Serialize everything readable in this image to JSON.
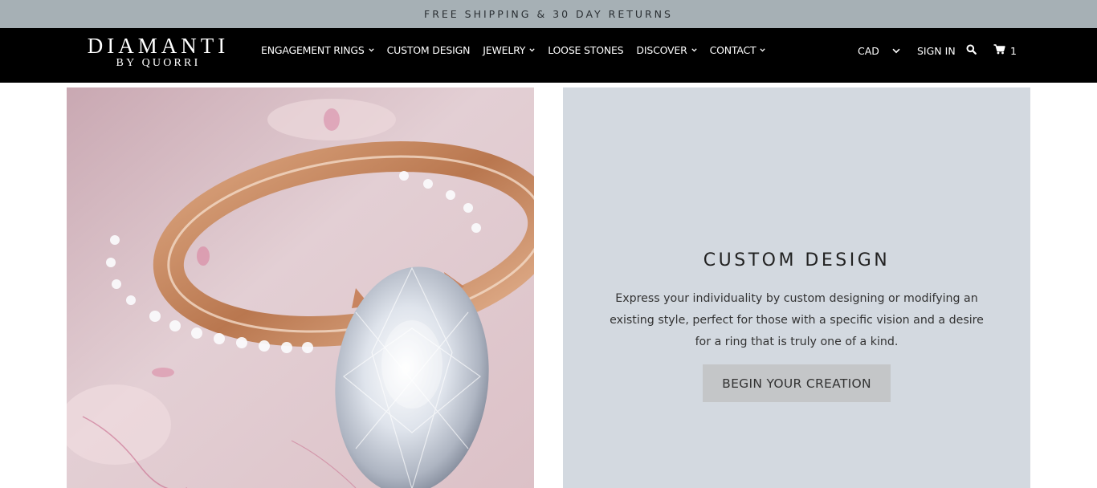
{
  "promo": {
    "text": "FREE SHIPPING & 30 DAY RETURNS"
  },
  "brand": {
    "line1": "DIAMANTI",
    "line2": "BY QUORRI"
  },
  "nav": {
    "engagement_rings": "ENGAGEMENT RINGS",
    "custom_design": "CUSTOM DESIGN",
    "jewelry": "JEWELRY",
    "loose_stones": "LOOSE STONES",
    "discover": "DISCOVER",
    "contact": "CONTACT"
  },
  "utility": {
    "currency": "CAD",
    "sign_in": "SIGN IN",
    "search_icon": "search-icon",
    "cart_icon": "cart-icon",
    "cart_count": "1"
  },
  "hero": {
    "image_subject": "Rose gold oval diamond engagement ring with pavé band on pink marble",
    "title": "CUSTOM DESIGN",
    "description": "Express your individuality by custom designing or modifying an existing style, perfect for those with a specific vision and a desire for a ring that is truly one of a kind.",
    "cta": "BEGIN YOUR CREATION"
  },
  "colors": {
    "promo_bg": "#a6b0b5",
    "header_bg": "#000000",
    "panel_bg": "#d3d9e0",
    "cta_bg": "#c4c6c8"
  }
}
